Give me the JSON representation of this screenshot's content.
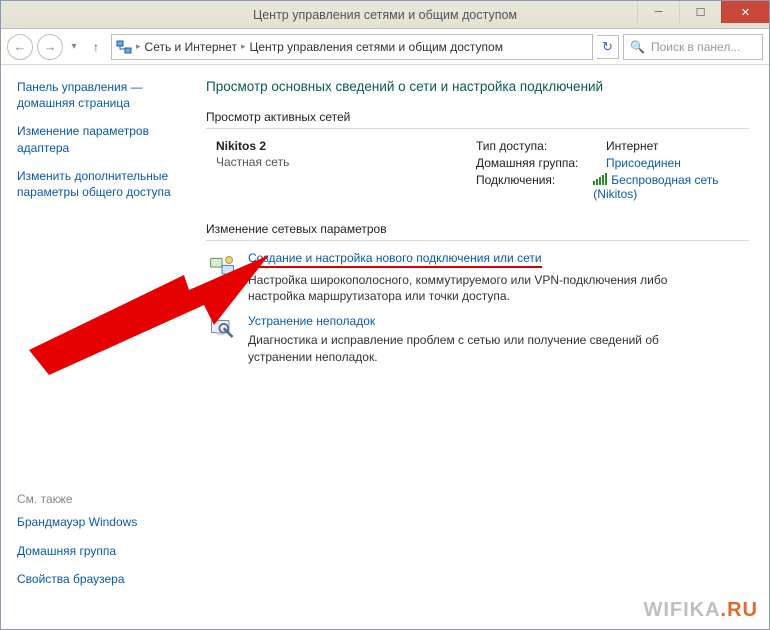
{
  "window": {
    "title": "Центр управления сетями и общим доступом"
  },
  "nav": {
    "crumb1": "Сеть и Интернет",
    "crumb2": "Центр управления сетями и общим доступом",
    "search_placeholder": "Поиск в панел..."
  },
  "sidebar": {
    "link1": "Панель управления — домашняя страница",
    "link2": "Изменение параметров адаптера",
    "link3": "Изменить дополнительные параметры общего доступа",
    "see_also": "См. также",
    "b1": "Брандмауэр Windows",
    "b2": "Домашняя группа",
    "b3": "Свойства браузера"
  },
  "main": {
    "heading": "Просмотр основных сведений о сети и настройка подключений",
    "active_title": "Просмотр активных сетей",
    "net": {
      "name": "Nikitos 2",
      "type": "Частная сеть",
      "access_label": "Тип доступа:",
      "access_value": "Интернет",
      "group_label": "Домашняя группа:",
      "group_value": "Присоединен",
      "conn_label": "Подключения:",
      "conn_value": "Беспроводная сеть (Nikitos)"
    },
    "change_title": "Изменение сетевых параметров",
    "item1": {
      "title": "Создание и настройка нового подключения или сети",
      "desc": "Настройка широкополосного, коммутируемого или VPN-подключения либо настройка маршрутизатора или точки доступа."
    },
    "item2": {
      "title": "Устранение неполадок",
      "desc": "Диагностика и исправление проблем с сетью или получение сведений об устранении неполадок."
    }
  },
  "watermark": {
    "a": "WIFIKA",
    "b": ".RU"
  }
}
